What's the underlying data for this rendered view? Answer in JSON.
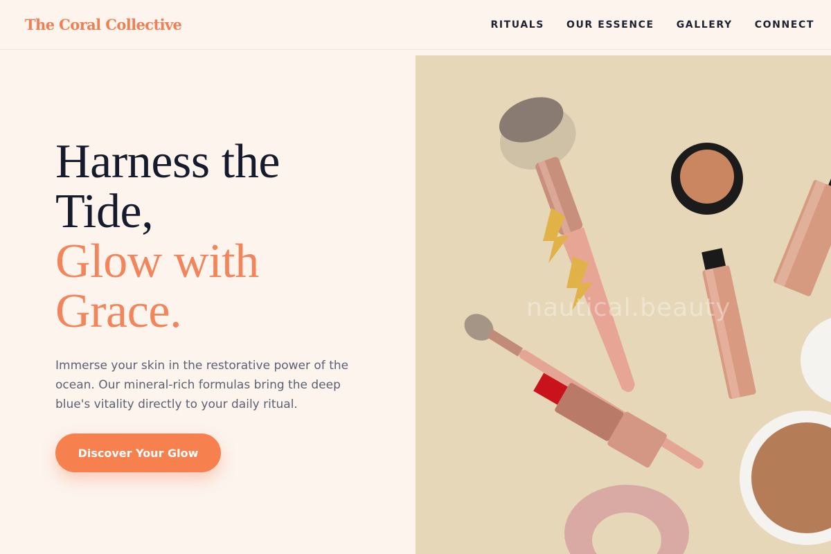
{
  "brand": {
    "name": "The Coral Collective"
  },
  "nav": {
    "items": [
      {
        "label": "RITUALS"
      },
      {
        "label": "OUR ESSENCE"
      },
      {
        "label": "GALLERY"
      },
      {
        "label": "CONNECT"
      }
    ]
  },
  "hero": {
    "headline_dark": [
      "Harness the",
      "Tide,"
    ],
    "headline_accent": [
      "Glow with",
      "Grace."
    ],
    "description": "Immerse your skin in the restorative power of the ocean. Our mineral-rich formulas bring the deep blue's vitality directly to your daily ritual.",
    "cta_label": "Discover Your Glow"
  },
  "image": {
    "watermark": "nautical.beauty",
    "subject": "flat-lay of makeup brushes, lipstick, mascara, compact powder, blush pot, scrunchie and earrings"
  },
  "colors": {
    "accent": "#f4845a",
    "button": "#f7804f",
    "dark_text": "#151b2c",
    "body_text": "#5b6170",
    "page_bg": "#fdf4ee",
    "photo_bg": "#e5d7b7"
  }
}
